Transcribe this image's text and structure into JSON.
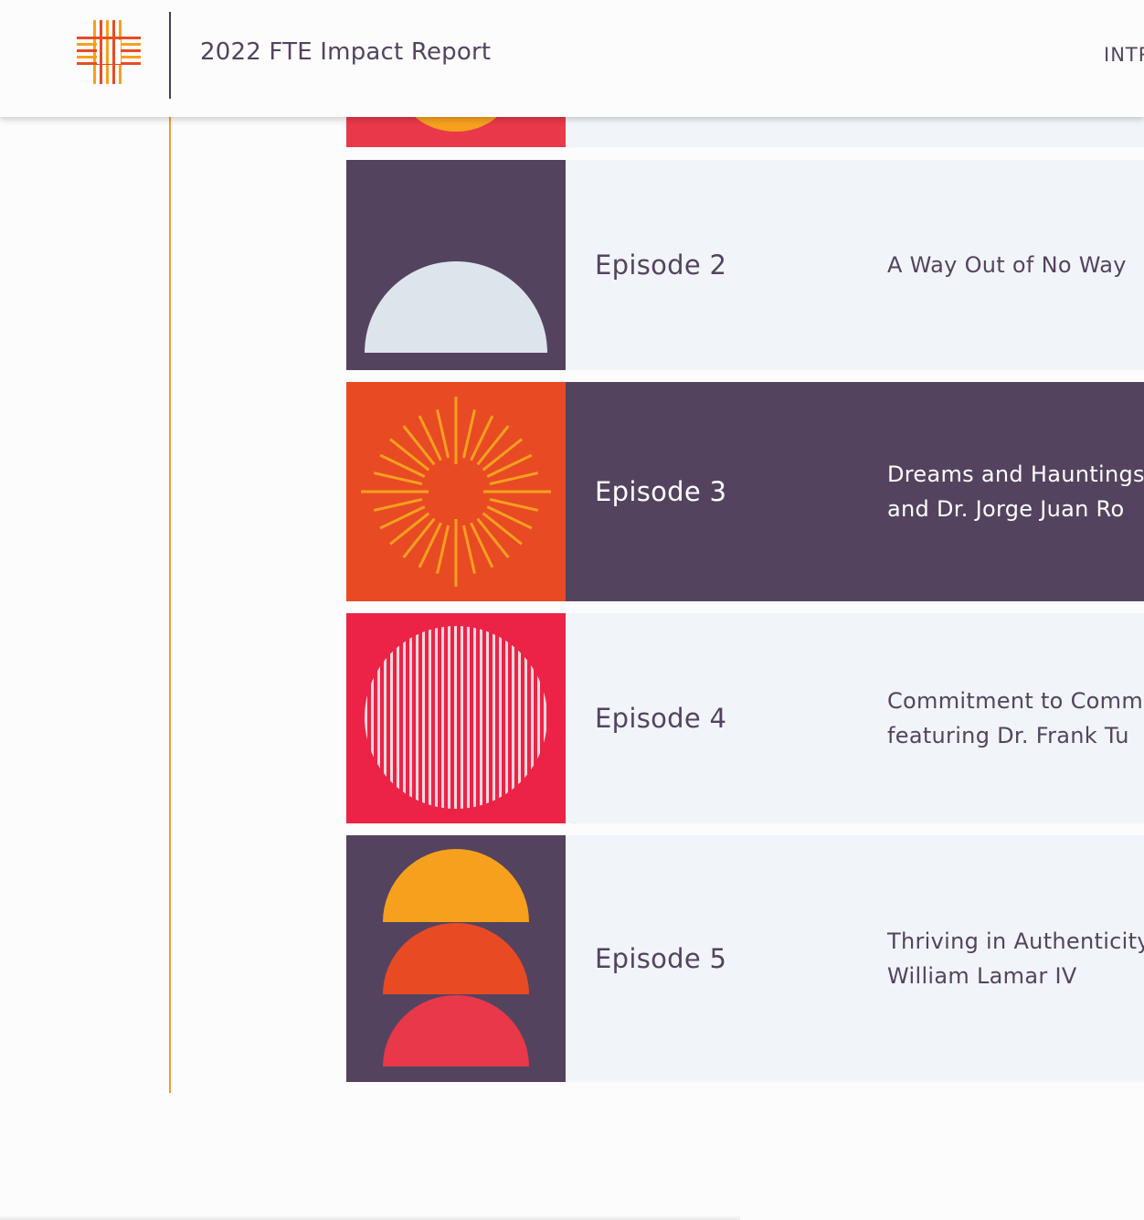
{
  "header": {
    "title": "2022 FTE Impact Report",
    "nav_item": "INTR",
    "logo_icon": "fte-cross-logo-icon"
  },
  "colors": {
    "purple": "#54435f",
    "orange": "#e84b24",
    "amber": "#f6a01e",
    "red": "#ec2347",
    "light_panel": "#f1f5fa",
    "timeline": "#f29a2e"
  },
  "episodes": [
    {
      "label": "",
      "title": ""
    },
    {
      "label": "Episode 2",
      "title": "A Way Out of No Way"
    },
    {
      "label": "Episode 3",
      "title": "Dreams and Hauntings\nand Dr. Jorge Juan Ro"
    },
    {
      "label": "Episode 4",
      "title": "Commitment to Comm\nfeaturing Dr. Frank Tu"
    },
    {
      "label": "Episode 5",
      "title": "Thriving in Authenticity\nWilliam Lamar IV"
    }
  ]
}
